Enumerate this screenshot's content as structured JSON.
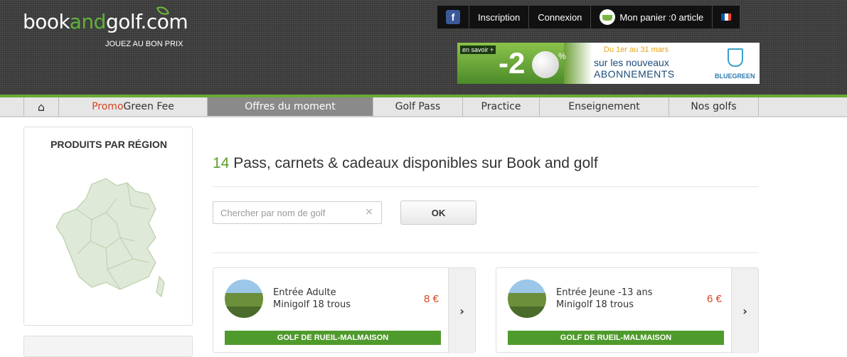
{
  "header": {
    "logo_book": "book",
    "logo_and": "and",
    "logo_golf": "golf.com",
    "tagline": "JOUEZ AU BON PRIX",
    "topbar": {
      "facebook": "f",
      "inscription": "Inscription",
      "connexion": "Connexion",
      "panier": "Mon panier :0 article"
    },
    "flag_colors": [
      "#0055a4",
      "#ffffff",
      "#ef4135"
    ]
  },
  "banner": {
    "en_savoir": "en savoir +",
    "discount": "-2",
    "pct": "%",
    "dates": "Du 1er au 31 mars",
    "line1": "sur les nouveaux",
    "line2": "ABONNEMENTS",
    "brand": "BLUEGREEN"
  },
  "nav": {
    "home_icon": "home-icon",
    "promo_part1": "Promo",
    "promo_part2": "Green Fee",
    "offres": "Offres du moment",
    "golfpass": "Golf Pass",
    "practice": "Practice",
    "enseignement": "Enseignement",
    "nosgolfs": "Nos golfs"
  },
  "sidebar": {
    "title": "PRODUITS PAR RÉGION"
  },
  "main": {
    "count": "14",
    "title_rest": " Pass, carnets & cadeaux disponibles sur Book and golf",
    "search_placeholder": "Chercher par nom de golf",
    "clear": "×",
    "ok_label": "OK"
  },
  "cards": [
    {
      "line1": "Entrée Adulte",
      "line2": "Minigolf 18 trous",
      "price": "8 €",
      "golf": "GOLF DE RUEIL-MALMAISON",
      "arrow": "›"
    },
    {
      "line1": "Entrée Jeune -13 ans",
      "line2": "Minigolf 18 trous",
      "price": "6 €",
      "golf": "GOLF DE RUEIL-MALMAISON",
      "arrow": "›"
    }
  ],
  "colors": {
    "accent_green": "#5b9e2d",
    "price_red": "#d8441f",
    "nav_active": "#8a8a8a"
  }
}
